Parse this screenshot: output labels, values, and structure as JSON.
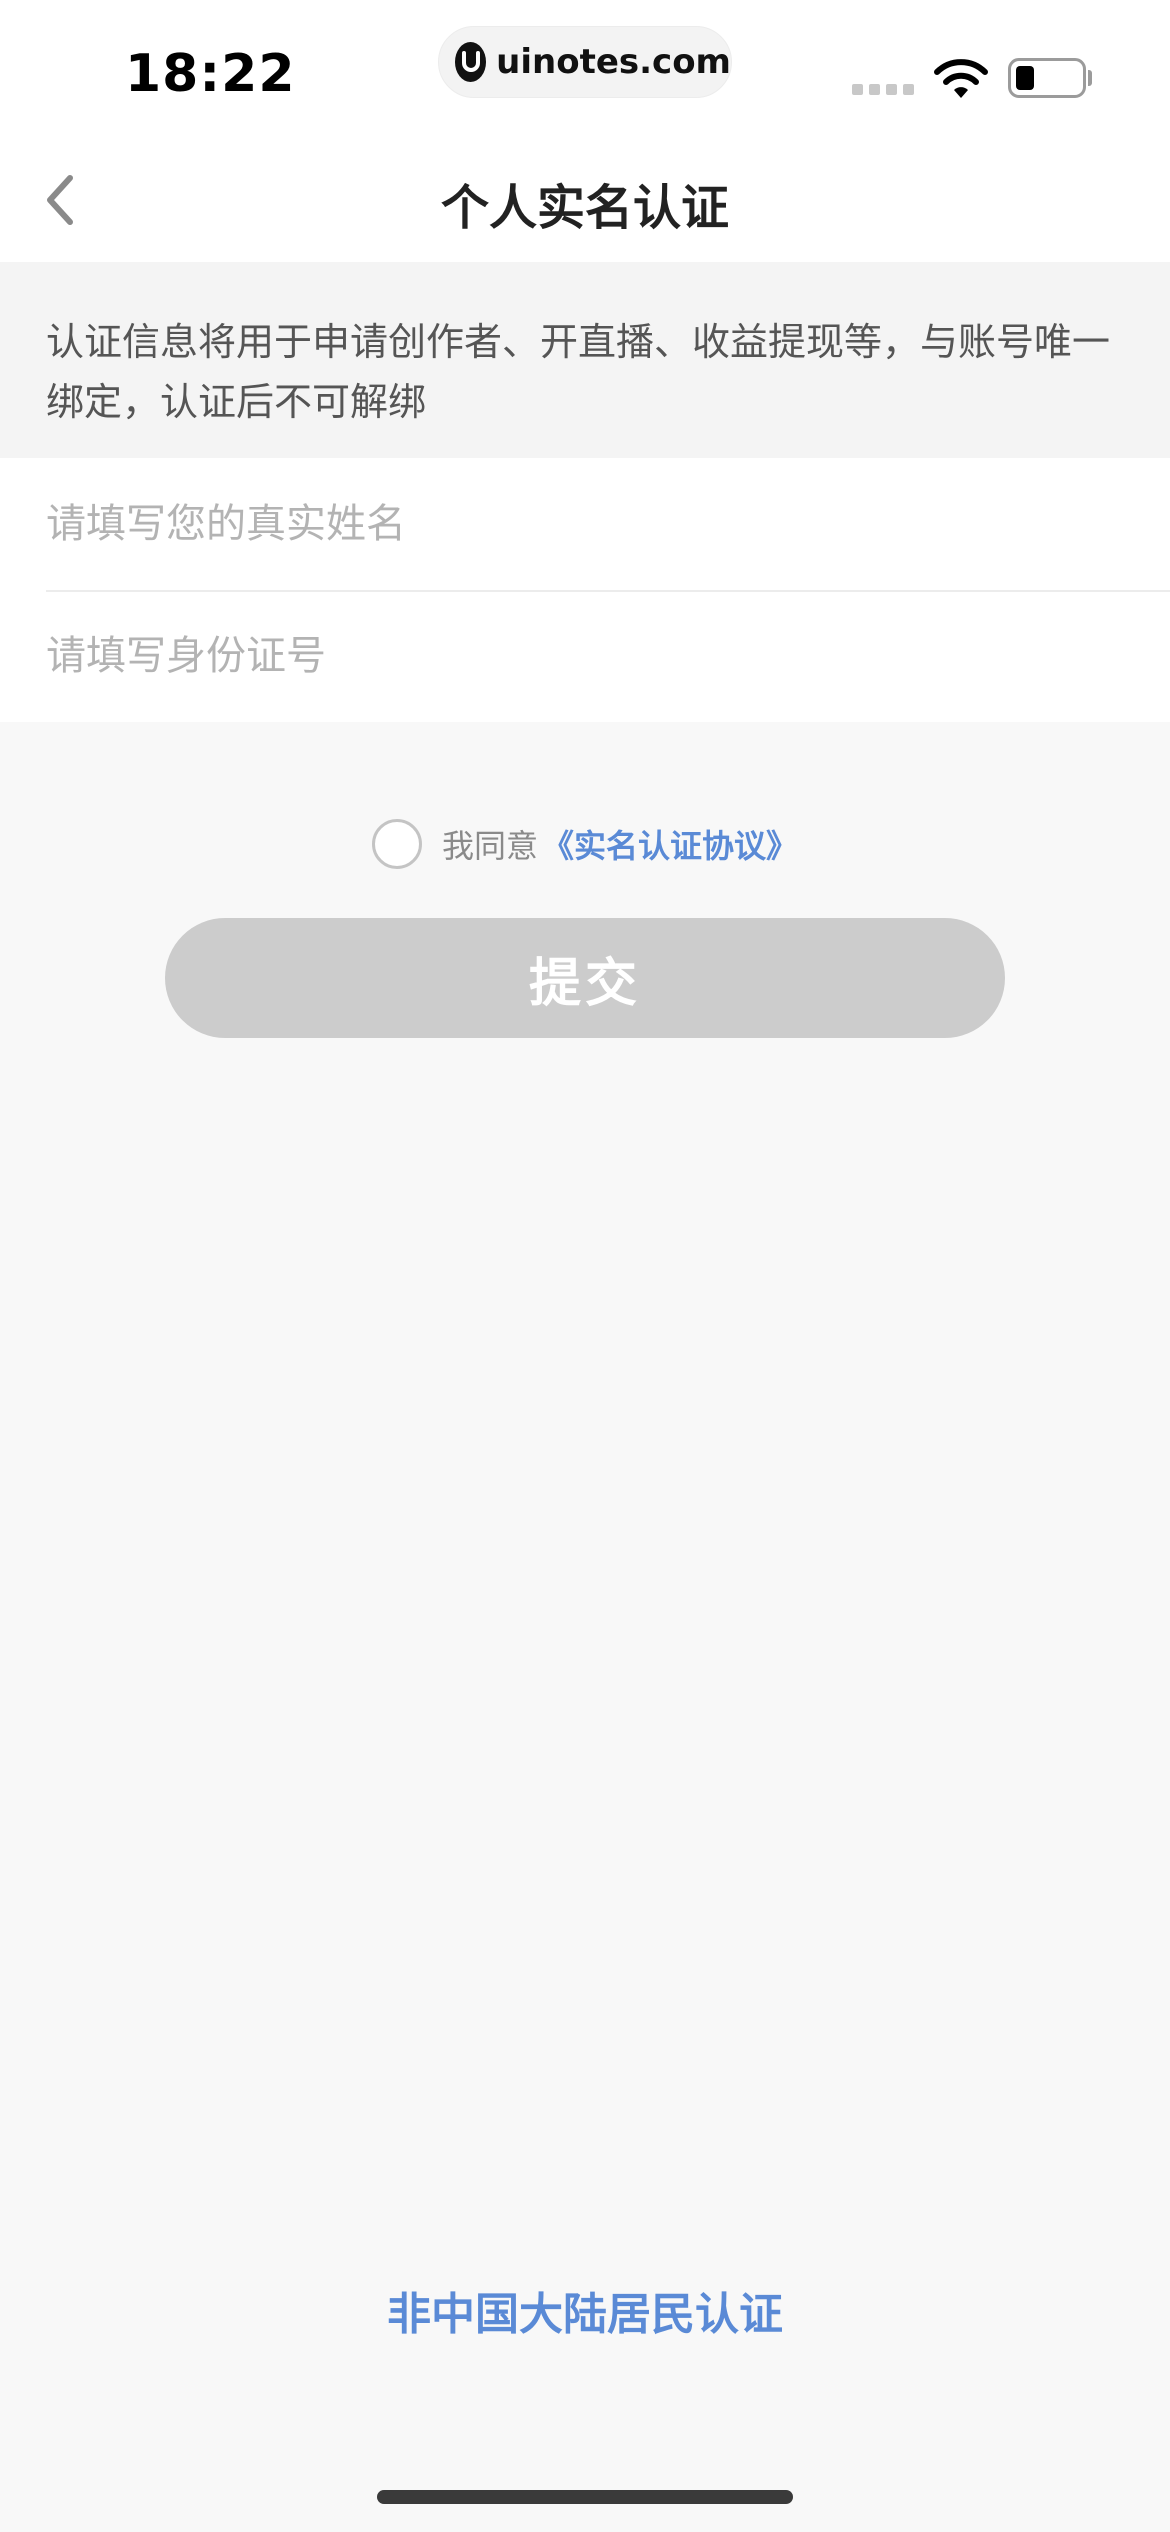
{
  "status_bar": {
    "time": "18:22",
    "url": "uinotes.com",
    "battery_level": 0.25
  },
  "nav": {
    "title": "个人实名认证"
  },
  "notice": {
    "text": "认证信息将用于申请创作者、开直播、收益提现等，与账号唯一绑定，认证后不可解绑"
  },
  "form": {
    "name_placeholder": "请填写您的真实姓名",
    "name_value": "",
    "id_placeholder": "请填写身份证号",
    "id_value": ""
  },
  "agreement": {
    "checked": false,
    "prefix": "我同意",
    "link_label": "《实名认证协议》"
  },
  "submit": {
    "label": "提交",
    "enabled": false
  },
  "alt_link": {
    "label": "非中国大陆居民认证"
  },
  "colors": {
    "accent": "#5a8ad6",
    "button_disabled": "#cccccc",
    "background": "#f8f8f8"
  }
}
